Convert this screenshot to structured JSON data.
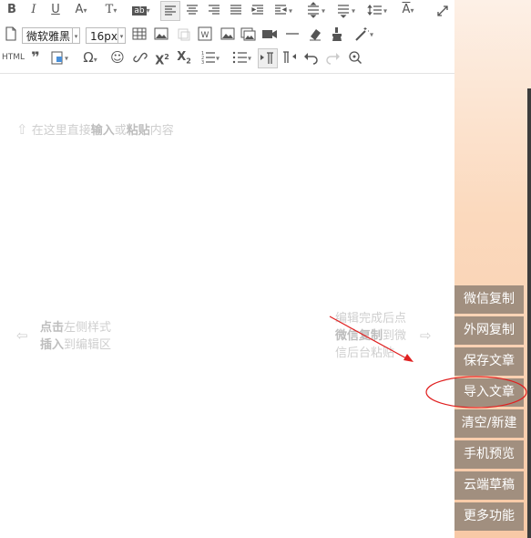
{
  "toolbar": {
    "font_family": "微软雅黑",
    "font_size": "16px",
    "html_label": "HTML",
    "omega_label": "Ω"
  },
  "placeholder": {
    "line1_a": "在这里直接",
    "line1_b": "输入",
    "line1_c": "或",
    "line1_d": "粘贴",
    "line1_e": "内容",
    "left_a": "点击",
    "left_b": "左侧样式",
    "left_c": "插入",
    "left_d": "到编辑区",
    "right_1": "编辑完成后点",
    "right_2a": "微信复制",
    "right_2b": "到微",
    "right_3": "信后台粘贴"
  },
  "side_menu": [
    {
      "label": "微信复制"
    },
    {
      "label": "外网复制"
    },
    {
      "label": "保存文章"
    },
    {
      "label": "导入文章"
    },
    {
      "label": "清空/新建"
    },
    {
      "label": "手机预览"
    },
    {
      "label": "云端草稿"
    },
    {
      "label": "更多功能"
    }
  ],
  "colors": {
    "side_button_bg": "#a18f7f",
    "annotation_red": "#e02020",
    "sidebar_gradient_top": "#fdf0e6",
    "sidebar_gradient_bottom": "#f8c9a6"
  }
}
